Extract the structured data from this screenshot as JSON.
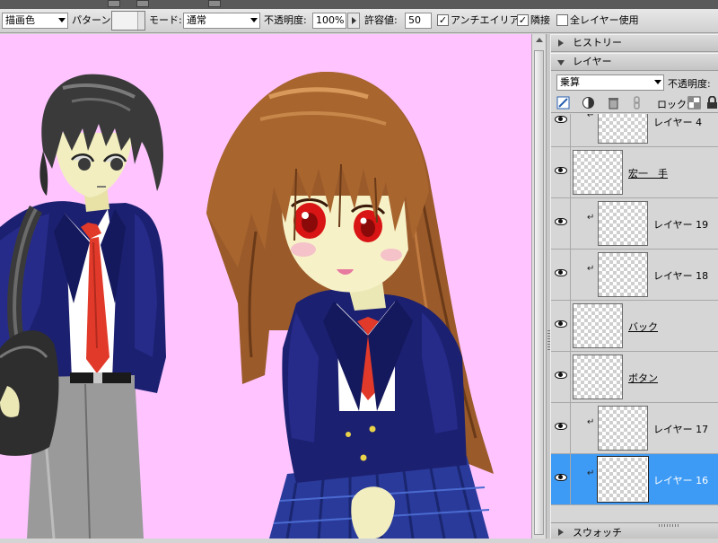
{
  "options_bar": {
    "source_select": "描画色",
    "pattern_label": "パターン:",
    "mode_label": "モード:",
    "mode_select": "通常",
    "opacity_label": "不透明度:",
    "opacity_value": "100%",
    "tolerance_label": "許容値:",
    "tolerance_value": "50",
    "antialias_label": "アンチエイリアス",
    "antialias_checked": "✓",
    "contiguous_label": "隣接",
    "contiguous_checked": "✓",
    "all_layers_label": "全レイヤー使用"
  },
  "panel": {
    "history_tab": "ヒストリー",
    "layers_tab": "レイヤー",
    "blend_mode": "乗算",
    "opacity_label": "不透明度:",
    "lock_label": "ロック:",
    "swatches_tab": "スウォッチ"
  },
  "layers": [
    {
      "name": "レイヤー 4",
      "clipped": true,
      "selected": false
    },
    {
      "name": "宏一　手",
      "clipped": false,
      "selected": false
    },
    {
      "name": "レイヤー 19",
      "clipped": true,
      "selected": false
    },
    {
      "name": "レイヤー 18",
      "clipped": true,
      "selected": false
    },
    {
      "name": "バック",
      "clipped": false,
      "selected": false
    },
    {
      "name": "ボタン",
      "clipped": false,
      "selected": false
    },
    {
      "name": "レイヤー 17",
      "clipped": true,
      "selected": false
    },
    {
      "name": "レイヤー 16",
      "clipped": true,
      "selected": true
    }
  ],
  "colors": {
    "canvas_bg": "#ffc4ff",
    "selected_layer": "#3e9bf5",
    "blazer": "#1c2070",
    "tie": "#e23a2a",
    "brown_hair": "#9a5a2a",
    "black_hair": "#3a3a3a"
  }
}
